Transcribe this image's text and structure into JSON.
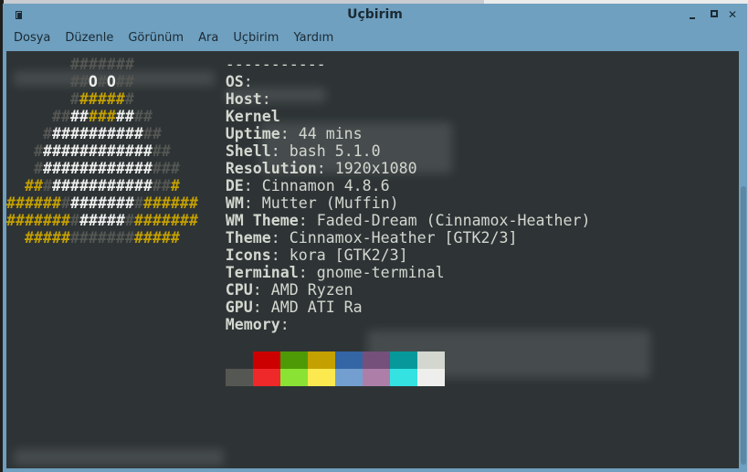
{
  "window": {
    "title": "Uçbirim"
  },
  "menu": [
    "Dosya",
    "Düzenle",
    "Görünüm",
    "Ara",
    "Uçbirim",
    "Yardım"
  ],
  "colors": {
    "gray": "#555753",
    "white": "#eeeeec",
    "yellow": "#c4a000",
    "bg": "#2e3436"
  },
  "separator": "-----------",
  "ascii": [
    [
      [
        "s",
        "       "
      ],
      [
        "g",
        "#######"
      ]
    ],
    [
      [
        "s",
        "       "
      ],
      [
        "g",
        "##"
      ],
      [
        "w",
        "O"
      ],
      [
        "g",
        "#"
      ],
      [
        "w",
        "O"
      ],
      [
        "g",
        "##"
      ]
    ],
    [
      [
        "s",
        "       "
      ],
      [
        "g",
        "#"
      ],
      [
        "y",
        "#####"
      ],
      [
        "g",
        "#"
      ]
    ],
    [
      [
        "s",
        "     "
      ],
      [
        "g",
        "##"
      ],
      [
        "w",
        "##"
      ],
      [
        "y",
        "###"
      ],
      [
        "w",
        "##"
      ],
      [
        "g",
        "##"
      ]
    ],
    [
      [
        "s",
        "    "
      ],
      [
        "g",
        "#"
      ],
      [
        "w",
        "##########"
      ],
      [
        "g",
        "##"
      ]
    ],
    [
      [
        "s",
        "   "
      ],
      [
        "g",
        "#"
      ],
      [
        "w",
        "############"
      ],
      [
        "g",
        "##"
      ]
    ],
    [
      [
        "s",
        "   "
      ],
      [
        "g",
        "#"
      ],
      [
        "w",
        "############"
      ],
      [
        "g",
        "###"
      ]
    ],
    [
      [
        "s",
        "  "
      ],
      [
        "y",
        "##"
      ],
      [
        "g",
        "#"
      ],
      [
        "w",
        "###########"
      ],
      [
        "g",
        "##"
      ],
      [
        "y",
        "#"
      ]
    ],
    [
      [
        "y",
        "######"
      ],
      [
        "g",
        "#"
      ],
      [
        "w",
        "#######"
      ],
      [
        "g",
        "#"
      ],
      [
        "y",
        "######"
      ]
    ],
    [
      [
        "y",
        "#######"
      ],
      [
        "g",
        "#"
      ],
      [
        "w",
        "#####"
      ],
      [
        "g",
        "#"
      ],
      [
        "y",
        "#######"
      ]
    ],
    [
      [
        "s",
        "  "
      ],
      [
        "y",
        "#####"
      ],
      [
        "g",
        "#######"
      ],
      [
        "y",
        "#####"
      ]
    ]
  ],
  "info": [
    {
      "label": "OS",
      "value": ""
    },
    {
      "label": "Host",
      "value": ""
    },
    {
      "label": "Kernel",
      "value": "",
      "nocolon": true
    },
    {
      "label": "Uptime",
      "value": "44 mins"
    },
    {
      "label": "Shell",
      "value": "bash 5.1.0"
    },
    {
      "label": "Resolution",
      "value": "1920x1080"
    },
    {
      "label": "DE",
      "value": "Cinnamon 4.8.6"
    },
    {
      "label": "WM",
      "value": "Mutter (Muffin)"
    },
    {
      "label": "WM Theme",
      "value": "Faded-Dream (Cinnamox-Heather)"
    },
    {
      "label": "Theme",
      "value": "Cinnamox-Heather [GTK2/3]"
    },
    {
      "label": "Icons",
      "value": "kora [GTK2/3]"
    },
    {
      "label": "Terminal",
      "value": "gnome-terminal"
    },
    {
      "label": "CPU",
      "value": "AMD Ryzen"
    },
    {
      "label": "GPU",
      "value": "AMD ATI Ra"
    },
    {
      "label": "Memory",
      "value": ""
    }
  ],
  "palette": {
    "normal": [
      "#2e3436",
      "#cc0000",
      "#4e9a06",
      "#c4a000",
      "#3465a4",
      "#75507b",
      "#06989a",
      "#d3d7cf"
    ],
    "bright": [
      "#555753",
      "#ef2929",
      "#8ae234",
      "#fce94f",
      "#729fcf",
      "#ad7fa8",
      "#34e2e2",
      "#eeeeec"
    ]
  }
}
